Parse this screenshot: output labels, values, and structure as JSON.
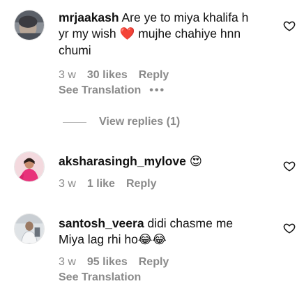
{
  "comments": [
    {
      "username": "mrjaakash",
      "text_lines": [
        "Are ye to miya khalifa h",
        "yr my wish",
        "mujhe chahiye hnn",
        "chumi"
      ],
      "emoji": "❤️",
      "time": "3 w",
      "likes": "30 likes",
      "reply": "Reply",
      "translation": "See Translation",
      "more": "•••",
      "view_replies": "View replies (1)"
    },
    {
      "username": "aksharasingh_mylove",
      "emoji": "😍",
      "time": "3 w",
      "likes": "1 like",
      "reply": "Reply"
    },
    {
      "username": "santosh_veera",
      "text_lines": [
        "didi chasme me",
        "Miya lag rhi ho"
      ],
      "emoji": "😂😂",
      "time": "3 w",
      "likes": "95 likes",
      "reply": "Reply",
      "translation": "See Translation"
    }
  ],
  "icons": {
    "like": "heart-outline-icon",
    "more": "more-options-icon"
  },
  "colors": {
    "meta_text": "#8a8a8a",
    "heart_emoji": "#e0243b"
  }
}
